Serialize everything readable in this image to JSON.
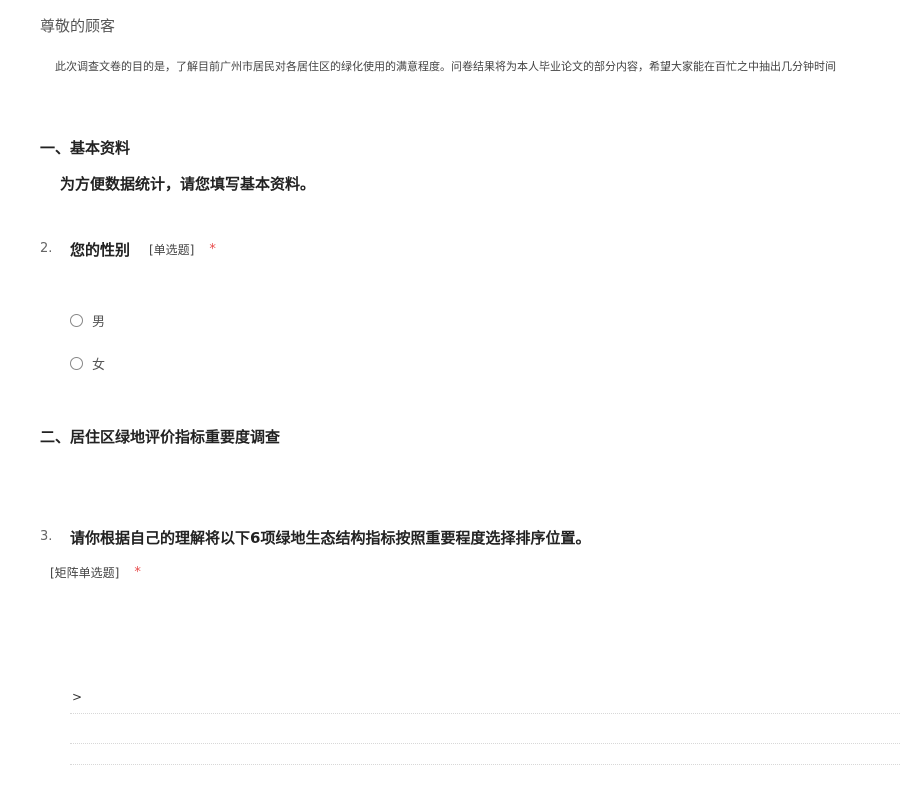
{
  "header": {
    "greeting": "尊敬的顾客",
    "intro": "此次调查文卷的目的是，了解目前广州市居民对各居住区的绿化使用的满意程度。问卷结果将为本人毕业论文的部分内容，希望大家能在百忙之中抽出几分钟时间"
  },
  "section1": {
    "title": "一、基本资料",
    "subtitle": "为方便数据统计，请您填写基本资料。"
  },
  "q2": {
    "number": "2.",
    "title": "您的性别",
    "type": "[单选题]",
    "required": "*",
    "options": [
      {
        "label": "男"
      },
      {
        "label": "女"
      }
    ]
  },
  "section2": {
    "title": "二、居住区绿地评价指标重要度调查"
  },
  "q3": {
    "number": "3.",
    "title": "请你根据自己的理解将以下6项绿地生态结构指标按照重要程度选择排序位置。",
    "type": "[矩阵单选题]",
    "required": "*",
    "matrix_marker": ">"
  }
}
